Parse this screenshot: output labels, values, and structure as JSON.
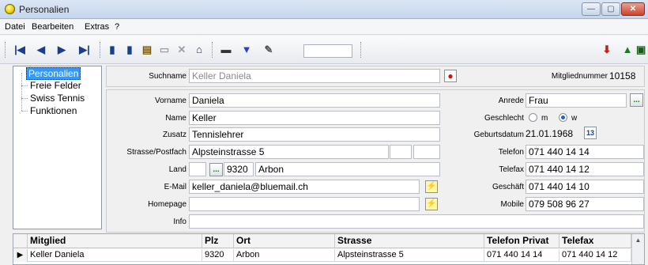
{
  "window": {
    "title": "Personalien",
    "min_glyph": "—",
    "max_glyph": "▢",
    "close_glyph": "✕"
  },
  "menu": [
    "Datei",
    "Bearbeiten",
    "Extras",
    "?"
  ],
  "toolbar": {
    "icons": {
      "first": "|◀",
      "prev": "◀",
      "next": "▶",
      "last": "▶|",
      "copy": "▮",
      "new": "▮",
      "edit": "▤",
      "save": "▭",
      "delete": "✕",
      "home": "⌂",
      "print": "▬",
      "filter": "▼",
      "clear_filter": "✎",
      "export": "⬇",
      "import": "▲",
      "disk": "▣"
    },
    "search_value": ""
  },
  "tree": {
    "items": [
      "Personalien",
      "Freie Felder",
      "Swiss Tennis",
      "Funktionen"
    ]
  },
  "form": {
    "suchname": {
      "label": "Suchname",
      "value": "Keller Daniela"
    },
    "mitgliednummer": {
      "label": "Mitgliednummer",
      "value": "10158"
    },
    "vorname": {
      "label": "Vorname",
      "value": "Daniela"
    },
    "name": {
      "label": "Name",
      "value": "Keller"
    },
    "zusatz": {
      "label": "Zusatz",
      "value": "Tennislehrer"
    },
    "strasse": {
      "label": "Strasse/Postfach",
      "value": "Alpsteinstrasse 5",
      "value2": "",
      "value3": ""
    },
    "land": {
      "label": "Land",
      "value": "",
      "plz": "9320",
      "ort": "Arbon",
      "picker": "..."
    },
    "email": {
      "label": "E-Mail",
      "value": "keller_daniela@bluemail.ch"
    },
    "homepage": {
      "label": "Homepage",
      "value": ""
    },
    "info": {
      "label": "Info",
      "value": ""
    },
    "anrede": {
      "label": "Anrede",
      "value": "Frau",
      "picker": "..."
    },
    "geschlecht": {
      "label": "Geschlecht",
      "options": [
        "m",
        "w"
      ],
      "selected": "w"
    },
    "geburtsdatum": {
      "label": "Geburtsdatum",
      "value": "21.01.1968",
      "cal_glyph": "13"
    },
    "telefon": {
      "label": "Telefon",
      "value": "071 440 14 14"
    },
    "telefax": {
      "label": "Telefax",
      "value": "071 440 14 12"
    },
    "geschaeft": {
      "label": "Geschäft",
      "value": "071 440 14 10"
    },
    "mobile": {
      "label": "Mobile",
      "value": "079 508 96 27"
    }
  },
  "grid": {
    "columns": [
      "Mitglied",
      "Plz",
      "Ort",
      "Strasse",
      "Telefon Privat",
      "Telefax"
    ],
    "rows": [
      [
        "Keller Daniela",
        "9320",
        "Arbon",
        "Alpsteinstrasse 5",
        "071 440 14 14",
        "071 440 14 12"
      ]
    ],
    "row_indicator": "▶",
    "scroll_glyph": "▲"
  }
}
